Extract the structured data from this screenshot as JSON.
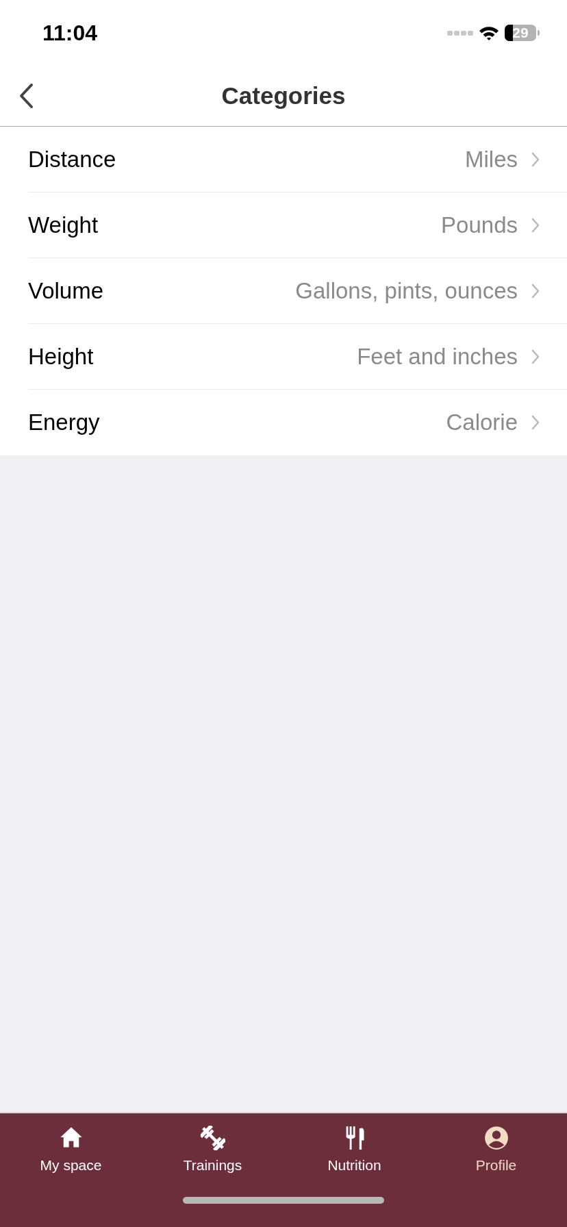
{
  "status_bar": {
    "time": "11:04",
    "battery": "29"
  },
  "nav_bar": {
    "title": "Categories"
  },
  "categories": [
    {
      "label": "Distance",
      "value": "Miles"
    },
    {
      "label": "Weight",
      "value": "Pounds"
    },
    {
      "label": "Volume",
      "value": "Gallons, pints, ounces"
    },
    {
      "label": "Height",
      "value": "Feet and inches"
    },
    {
      "label": "Energy",
      "value": "Calorie"
    }
  ],
  "tab_bar": [
    {
      "label": "My space",
      "kind": "home",
      "selected": false
    },
    {
      "label": "Trainings",
      "kind": "dumbbell",
      "selected": false
    },
    {
      "label": "Nutrition",
      "kind": "cutlery",
      "selected": false
    },
    {
      "label": "Profile",
      "kind": "profile",
      "selected": true
    }
  ]
}
